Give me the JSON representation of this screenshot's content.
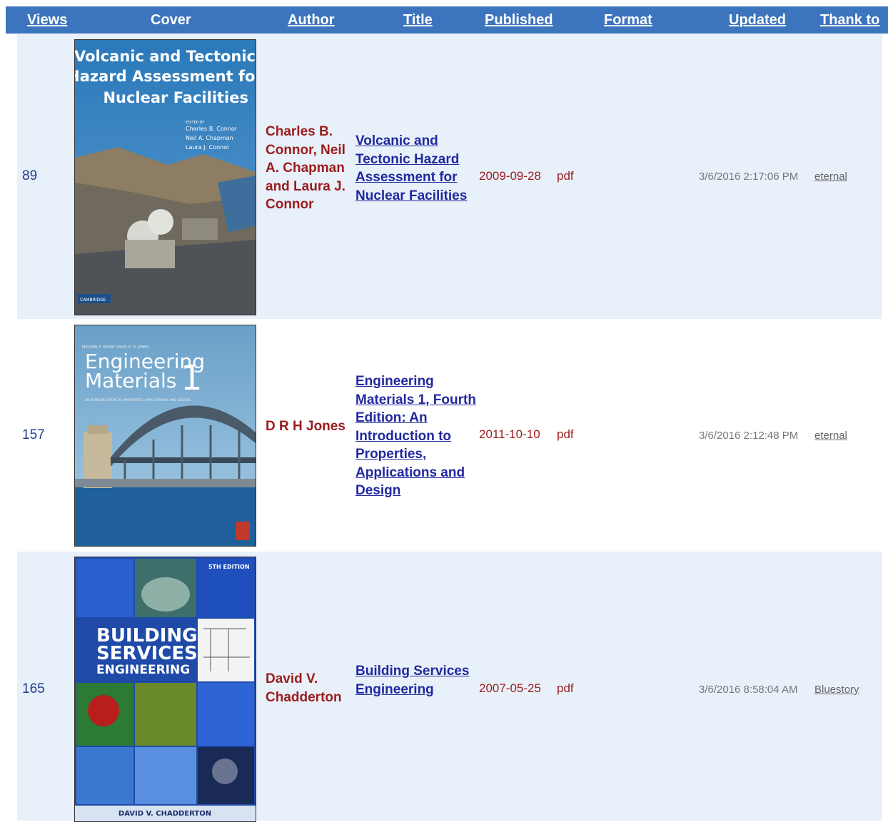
{
  "header": {
    "views": "Views",
    "cover": "Cover",
    "author": "Author",
    "title": "Title",
    "published": "Published",
    "format": "Format",
    "updated": "Updated",
    "thank_to": "Thank  to"
  },
  "rows": [
    {
      "views": "89",
      "cover": {
        "title_lines": [
          "Volcanic and Tectonic",
          "Hazard Assessment for",
          "Nuclear Facilities"
        ],
        "editors_label": "EDITED BY",
        "editors": [
          "Charles B. Connor",
          "Neil A. Chapman",
          "Laura J. Connor"
        ],
        "publisher": "CAMBRIDGE"
      },
      "author": "Charles B. Connor, Neil A. Chapman and Laura J. Connor",
      "title": "Volcanic and Tectonic Hazard Assessment for Nuclear Facilities",
      "published": "2009-09-28",
      "format": "pdf",
      "updated": "3/6/2016 2:17:06 PM",
      "thank": "eternal"
    },
    {
      "views": "157",
      "cover": {
        "authors_line": "MICHAEL F. ASHBY  DAVID R. H. JONES",
        "title_lines": [
          "Engineering",
          "Materials"
        ],
        "number": "1",
        "subtitle": "AN INTRODUCTION TO PROPERTIES, APPLICATIONS AND DESIGN"
      },
      "author": "D R H Jones",
      "title": "Engineering Materials 1, Fourth Edition: An Introduction to Properties, Applications and Design",
      "published": "2011-10-10",
      "format": "pdf",
      "updated": "3/6/2016 2:12:48 PM",
      "thank": "eternal"
    },
    {
      "views": "165",
      "cover": {
        "edition": "5TH EDITION",
        "title_lines": [
          "BUILDING",
          "SERVICES",
          "ENGINEERING"
        ],
        "author_line": "DAVID V. CHADDERTON"
      },
      "author": "David V. Chadderton",
      "title": "Building Services Engineering",
      "published": "2007-05-25",
      "format": "pdf",
      "updated": "3/6/2016 8:58:04 AM",
      "thank": "Bluestory"
    }
  ],
  "colors": {
    "header_bg": "#3c74bd",
    "row_shade": "#e8f0fa",
    "author_red": "#9b1c1c",
    "title_blue": "#22299e"
  }
}
